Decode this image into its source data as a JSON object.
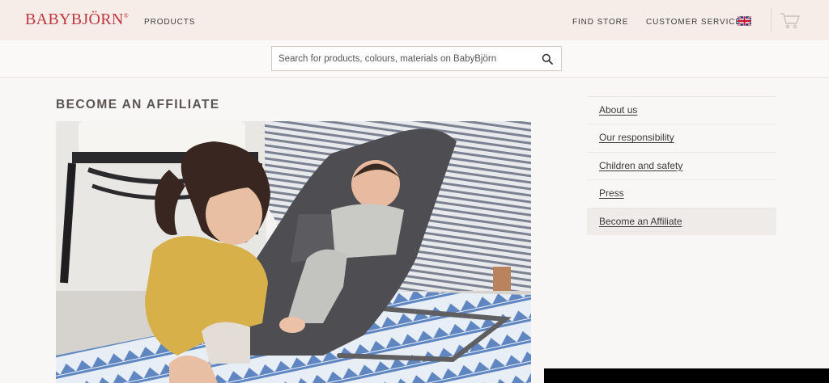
{
  "header": {
    "logo": "BABYBJÖRN",
    "logo_mark": "®",
    "nav": {
      "products": "PRODUCTS",
      "find_store": "FIND STORE",
      "customer_service": "CUSTOMER SERVICE"
    },
    "flag_icon": "uk-flag-icon",
    "cart_icon": "cart-icon"
  },
  "search": {
    "placeholder": "Search for products, colours, materials on BabyBjörn",
    "icon": "search-icon"
  },
  "main": {
    "title": "BECOME AN AFFILIATE"
  },
  "sidebar": {
    "items": [
      {
        "label": "About us"
      },
      {
        "label": "Our responsibility"
      },
      {
        "label": "Children and safety"
      },
      {
        "label": "Press"
      },
      {
        "label": "Become an Affiliate"
      }
    ],
    "active_index": 4
  },
  "colors": {
    "brand": "#c0373f",
    "topbar": "#f7ede8"
  }
}
